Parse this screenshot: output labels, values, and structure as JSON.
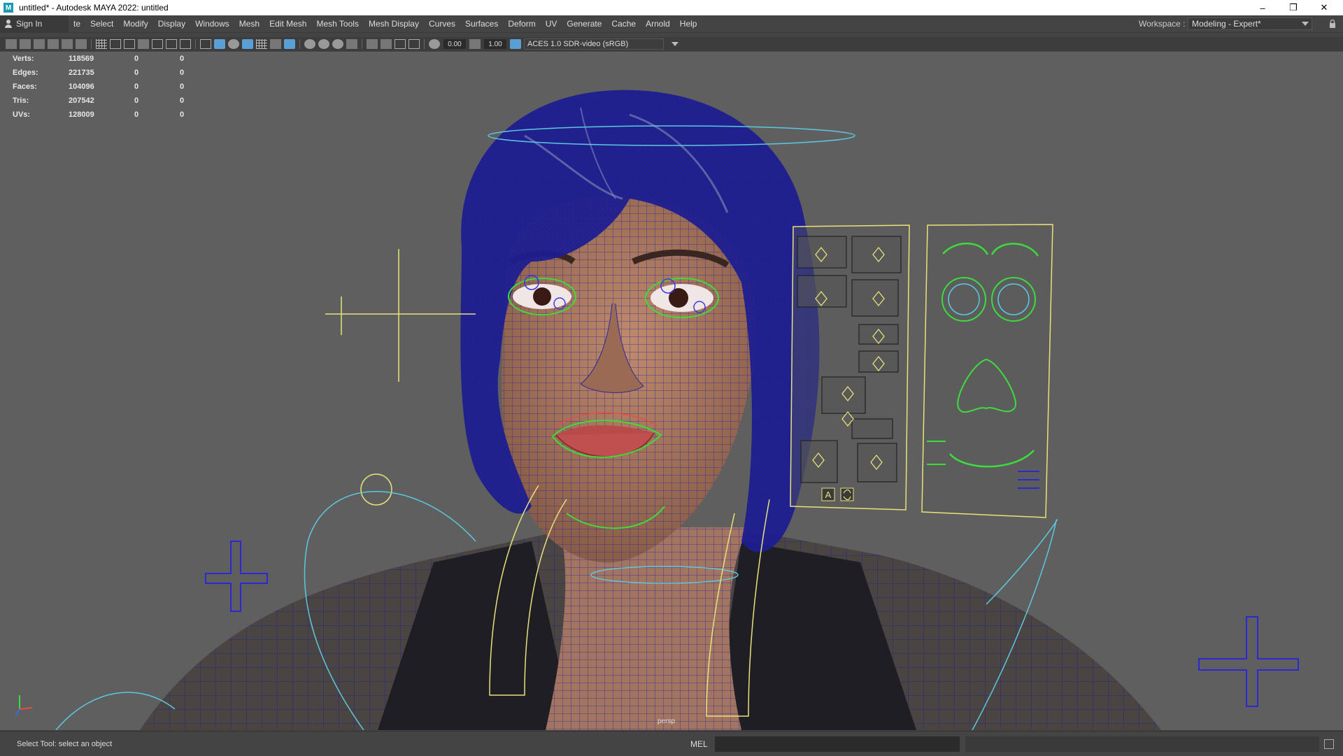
{
  "window": {
    "title": "untitled* - Autodesk MAYA 2022: untitled",
    "logo_letter": "M",
    "minimize": "–",
    "restore": "❐",
    "close": "✕"
  },
  "menubar": {
    "sign_in": "Sign In",
    "items": [
      "te",
      "Select",
      "Modify",
      "Display",
      "Windows",
      "Mesh",
      "Edit Mesh",
      "Mesh Tools",
      "Mesh Display",
      "Curves",
      "Surfaces",
      "Deform",
      "UV",
      "Generate",
      "Cache",
      "Arnold",
      "Help"
    ],
    "workspace_label": "Workspace :",
    "workspace_value": "Modeling - Expert*"
  },
  "panel_toolbar": {
    "exposure": "0.00",
    "gamma": "1.00",
    "color_space": "ACES 1.0 SDR-video (sRGB)"
  },
  "heads_up": {
    "rows": [
      {
        "label": "Verts:",
        "value": "118569",
        "sel1": "0",
        "sel2": "0"
      },
      {
        "label": "Edges:",
        "value": "221735",
        "sel1": "0",
        "sel2": "0"
      },
      {
        "label": "Faces:",
        "value": "104096",
        "sel1": "0",
        "sel2": "0"
      },
      {
        "label": "Tris:",
        "value": "207542",
        "sel1": "0",
        "sel2": "0"
      },
      {
        "label": "UVs:",
        "value": "128009",
        "sel1": "0",
        "sel2": "0"
      }
    ]
  },
  "viewport": {
    "camera": "persp",
    "picker_letter": "A"
  },
  "statusbar": {
    "help_line": "Select Tool: select an object",
    "command_type": "MEL"
  },
  "colors": {
    "viewport_bg": "#5f5f5f",
    "wire_blue": "#1c1c9a",
    "ctrl_yellow": "#e8e27a",
    "ctrl_cyan": "#5cc8e0",
    "ctrl_green": "#3ddc3d",
    "skin": "#b07a5c"
  }
}
